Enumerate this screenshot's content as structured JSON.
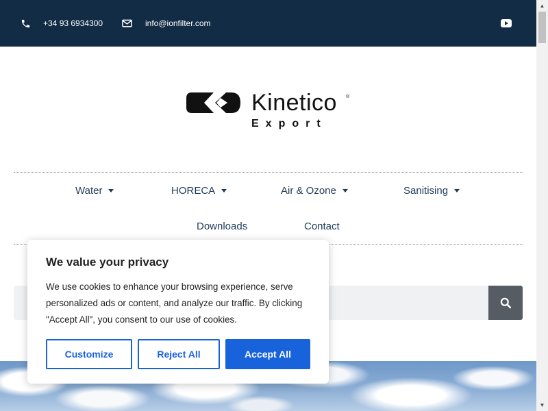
{
  "topbar": {
    "phone": "+34 93 6934300",
    "email": "info@ionfilter.com",
    "icons": {
      "phone": "phone-icon",
      "email": "envelope-icon",
      "social": "youtube-icon"
    }
  },
  "logo": {
    "word": "Kinetico",
    "sub": "Export",
    "reg": "®"
  },
  "nav": {
    "items": [
      {
        "label": "Water",
        "has_dropdown": true
      },
      {
        "label": "HORECA",
        "has_dropdown": true
      },
      {
        "label": "Air & Ozone",
        "has_dropdown": true
      },
      {
        "label": "Sanitising",
        "has_dropdown": true
      },
      {
        "label": "Downloads",
        "has_dropdown": false
      },
      {
        "label": "Contact",
        "has_dropdown": false
      }
    ]
  },
  "search": {
    "icon": "search-icon"
  },
  "cookie": {
    "title": "We value your privacy",
    "text": "We use cookies to enhance your browsing experience, serve personalized ads or content, and analyze our traffic. By clicking \"Accept All\", you consent to our use of cookies.",
    "customize_label": "Customize",
    "reject_label": "Reject All",
    "accept_label": "Accept All"
  },
  "colors": {
    "topbar": "#132c45",
    "nav_text": "#1f3b57",
    "accent": "#1863dc",
    "search_button": "#565c63"
  }
}
